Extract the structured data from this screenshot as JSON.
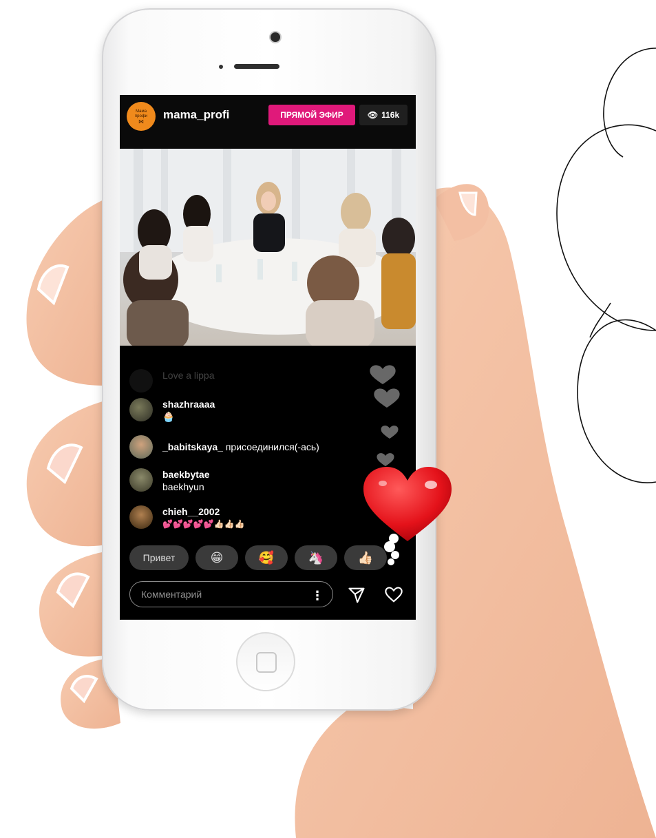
{
  "stream": {
    "username": "mama_profi",
    "avatar_text": "Мама профи",
    "live_label": "ПРЯМОЙ ЭФИР",
    "viewers": "116k"
  },
  "comments": [
    {
      "user": "",
      "text": "Love a lippa",
      "faded": true
    },
    {
      "user": "shazhraaaa",
      "text": "🧁"
    },
    {
      "user": "_babitskaya_",
      "text": "присоединился(-ась)"
    },
    {
      "user": "baekbytae",
      "text": "baekhyun"
    },
    {
      "user": "chieh__2002",
      "text": "💕💕💕💕💕👍🏻👍🏻👍🏻"
    }
  ],
  "quick_replies": [
    "Привет",
    "😁",
    "🥰",
    "🦄",
    "👍🏻"
  ],
  "input": {
    "placeholder": "Комментарий"
  },
  "colors": {
    "live": "#e0197a",
    "avatar": "#f08a1c",
    "heart": "#e4121a"
  }
}
